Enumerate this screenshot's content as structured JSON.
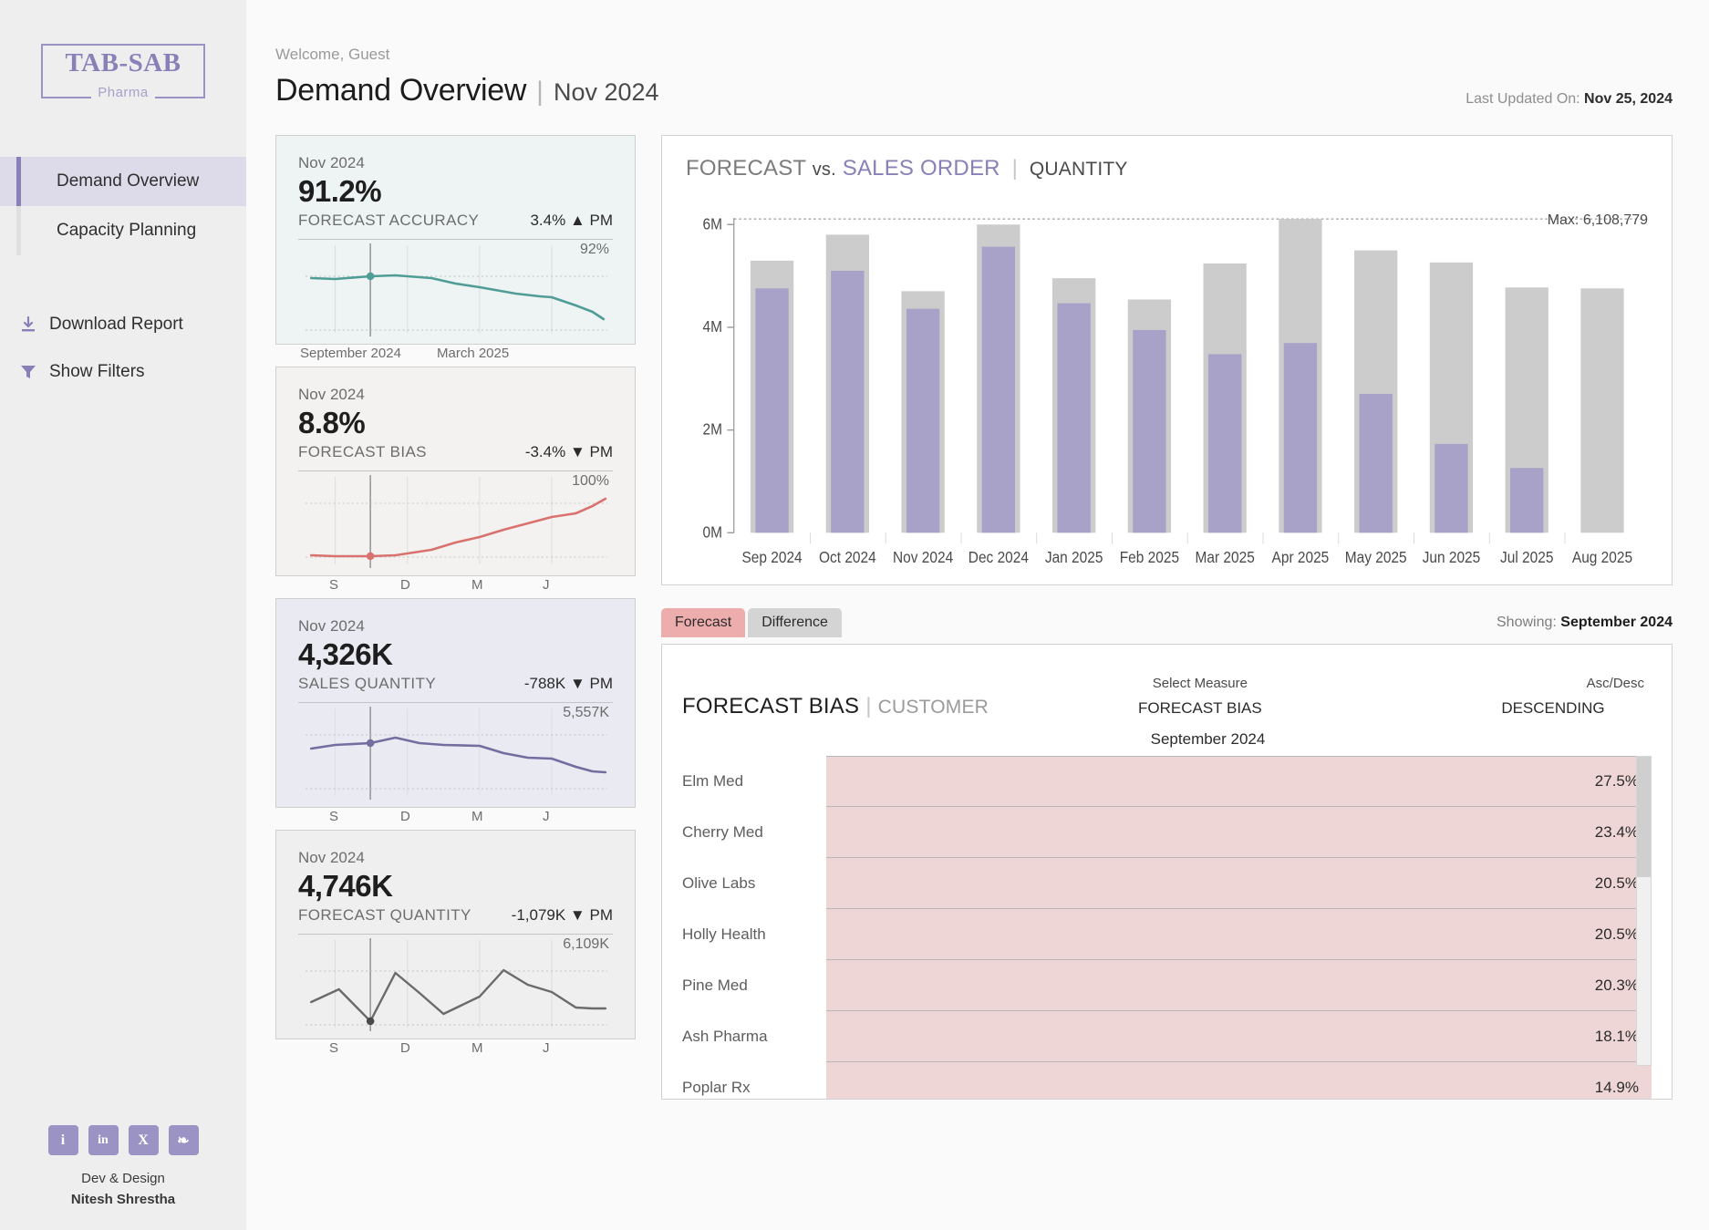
{
  "sidebar": {
    "logo": {
      "main": "TAB-SAB",
      "sub": "Pharma"
    },
    "nav": [
      {
        "label": "Demand Overview",
        "active": true
      },
      {
        "label": "Capacity Planning",
        "active": false
      }
    ],
    "tools": [
      {
        "label": "Download Report",
        "icon": "download-icon"
      },
      {
        "label": "Show Filters",
        "icon": "filter-icon"
      }
    ],
    "social": [
      {
        "icon": "info-icon",
        "glyph": "i"
      },
      {
        "icon": "linkedin-icon",
        "glyph": "in"
      },
      {
        "icon": "x-twitter-icon",
        "glyph": "X"
      },
      {
        "icon": "share-icon",
        "glyph": "❧"
      }
    ],
    "credit_line1": "Dev & Design",
    "credit_line2": "Nitesh Shrestha"
  },
  "header": {
    "welcome": "Welcome, Guest",
    "title": "Demand Overview",
    "separator": "|",
    "period": "Nov 2024",
    "updated_label": "Last Updated On: ",
    "updated_value": "Nov 25, 2024"
  },
  "kpis": [
    {
      "period": "Nov 2024",
      "value": "91.2%",
      "label": "FORECAST ACCURACY",
      "delta": "3.4% ▲ PM",
      "max_label": "92%",
      "axis": [
        "September 2024",
        "March 2025"
      ],
      "accent": "#4f9d96"
    },
    {
      "period": "Nov 2024",
      "value": "8.8%",
      "label": "FORECAST BIAS",
      "delta": "-3.4% ▼ PM",
      "max_label": "100%",
      "axis": [
        "S",
        "D",
        "M",
        "J"
      ],
      "accent": "#d9726f"
    },
    {
      "period": "Nov 2024",
      "value": "4,326K",
      "label": "SALES QUANTITY",
      "delta": "-788K ▼ PM",
      "max_label": "5,557K",
      "axis": [
        "S",
        "D",
        "M",
        "J"
      ],
      "accent": "#756ca0"
    },
    {
      "period": "Nov 2024",
      "value": "4,746K",
      "label": "FORECAST QUANTITY",
      "delta": "-1,079K ▼ PM",
      "max_label": "6,109K",
      "axis": [
        "S",
        "D",
        "M",
        "J"
      ],
      "accent": "#6b6b6b"
    }
  ],
  "bar_panel": {
    "title_a": "FORECAST",
    "title_vs": "vs.",
    "title_b": "SALES ORDER",
    "pipe": "|",
    "title_sub": "QUANTITY",
    "max_annotation": "Max: 6,108,779"
  },
  "tabs": {
    "items": [
      {
        "label": "Forecast",
        "active": true
      },
      {
        "label": "Difference",
        "active": false
      }
    ],
    "showing_label": "Showing: ",
    "showing_value": "September 2024"
  },
  "bias_panel": {
    "title": "FORECAST BIAS",
    "pipe": "|",
    "dimension": "CUSTOMER",
    "measure_label": "Select Measure",
    "measure_value": "FORECAST BIAS",
    "order_label": "Asc/Desc",
    "order_value": "DESCENDING",
    "month": "September 2024"
  },
  "chart_data": [
    {
      "type": "bar",
      "title": "FORECAST vs. SALES ORDER | QUANTITY",
      "xlabel": "",
      "ylabel": "",
      "ylim": [
        0,
        6600000
      ],
      "yticks": [
        "0M",
        "2M",
        "4M",
        "6M"
      ],
      "ytick_values": [
        0,
        2000000,
        4000000,
        6000000
      ],
      "grid": false,
      "max_line": 6108779,
      "max_annotation": "Max: 6,108,779",
      "legend": [
        "FORECAST",
        "SALES ORDER"
      ],
      "categories": [
        "Sep 2024",
        "Oct 2024",
        "Nov 2024",
        "Dec 2024",
        "Jan 2025",
        "Feb 2025",
        "Mar 2025",
        "Apr 2025",
        "May 2025",
        "Jun 2025",
        "Jul 2025",
        "Aug 2025"
      ],
      "series": [
        {
          "name": "FORECAST",
          "color": "#cccccc",
          "values": [
            5300000,
            5800000,
            4700000,
            6000000,
            4950000,
            4550000,
            5250000,
            6108779,
            5500000,
            5270000,
            4800000,
            4780000
          ]
        },
        {
          "name": "SALES ORDER",
          "color": "#a8a2c8",
          "values": [
            4760000,
            5100000,
            4370000,
            5570000,
            4470000,
            3950000,
            3480000,
            3700000,
            2700000,
            1730000,
            1270000,
            0
          ]
        }
      ]
    },
    {
      "type": "bar",
      "orientation": "horizontal",
      "title": "FORECAST BIAS | CUSTOMER",
      "subtitle": "September 2024",
      "xlabel": "",
      "ylabel": "",
      "bar_color": "#eed6d6",
      "categories": [
        "Elm Med",
        "Cherry Med",
        "Olive Labs",
        "Holly Health",
        "Pine Med",
        "Ash Pharma",
        "Poplar Rx"
      ],
      "values": [
        27.5,
        23.4,
        20.5,
        20.5,
        20.3,
        18.1,
        14.9
      ],
      "value_labels": [
        "27.5%",
        "23.4%",
        "20.5%",
        "20.5%",
        "20.3%",
        "18.1%",
        "14.9%"
      ]
    },
    {
      "type": "line",
      "name": "forecast-accuracy-sparkline",
      "values": [
        91.0,
        90.8,
        91.2,
        91.4,
        91.3,
        91.0,
        90.6,
        88.8,
        88.4,
        87.9,
        86.4,
        86.1,
        83.0
      ],
      "highlight_index": 2,
      "reference_label": "92%",
      "xlabels": [
        "September 2024",
        "March 2025"
      ]
    },
    {
      "type": "line",
      "name": "forecast-bias-sparkline",
      "values": [
        8.5,
        8.2,
        8.8,
        9.2,
        10.5,
        13.5,
        17.0,
        21.0,
        26.0,
        28.5,
        31.0,
        37.0,
        43.0
      ],
      "highlight_index": 2,
      "reference_label": "100%",
      "xlabels": [
        "S",
        "D",
        "M",
        "J"
      ]
    },
    {
      "type": "line",
      "name": "sales-quantity-sparkline",
      "values": [
        4650,
        4780,
        4900,
        5100,
        4880,
        4820,
        4800,
        4560,
        4400,
        4380,
        4120,
        3980,
        3980
      ],
      "highlight_index": 2,
      "reference_label": "5,557K",
      "xlabels": [
        "S",
        "D",
        "M",
        "J"
      ]
    },
    {
      "type": "line",
      "name": "forecast-quantity-sparkline",
      "values": [
        3700,
        4600,
        2900,
        5200,
        3200,
        2600,
        3900,
        5400,
        4500,
        4100,
        3000,
        3020,
        3010
      ],
      "highlight_index": 2,
      "reference_label": "6,109K",
      "xlabels": [
        "S",
        "D",
        "M",
        "J"
      ]
    }
  ]
}
